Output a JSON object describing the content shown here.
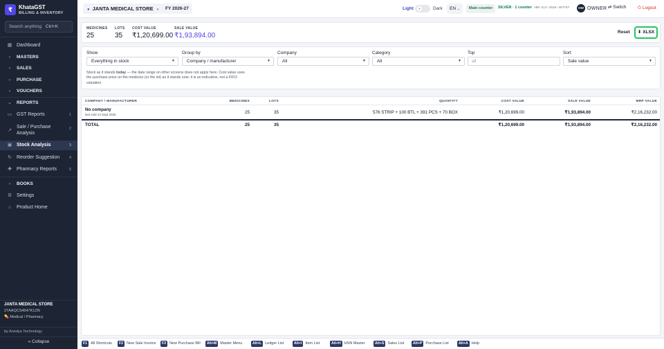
{
  "app": {
    "name": "KhataGST",
    "subtitle": "BILLING & INVENTORY",
    "logo_glyph": "₹"
  },
  "search": {
    "placeholder": "Search anything",
    "shortcut": "Ctrl+K"
  },
  "sidebar": {
    "items": [
      {
        "label": "Dashboard",
        "icon": "grid-icon"
      },
      {
        "label": "MASTERS",
        "icon": "chevron-right-icon"
      },
      {
        "label": "SALES",
        "icon": "chevron-right-icon"
      },
      {
        "label": "PURCHASE",
        "icon": "chevron-right-icon"
      },
      {
        "label": "VOUCHERS",
        "icon": "chevron-right-icon"
      },
      {
        "label": "REPORTS",
        "icon": "chevron-down-icon"
      },
      {
        "label": "GST Reports",
        "num": "1"
      },
      {
        "label": "Sale / Purchase Analysis",
        "num": "2"
      },
      {
        "label": "Stock Analysis",
        "num": "3"
      },
      {
        "label": "Reorder Suggestion",
        "num": "4"
      },
      {
        "label": "Pharmacy Reports",
        "num": "5"
      },
      {
        "label": "BOOKS",
        "icon": "chevron-right-icon"
      },
      {
        "label": "Settings",
        "icon": "gear-icon"
      },
      {
        "label": "Product Home",
        "icon": "home-icon"
      }
    ],
    "store": {
      "name": "JANTA MEDICAL STORE",
      "gstin": "27AAQCS4547K1ZN",
      "type": "Medical / Pharmacy"
    },
    "by": "by Anedya Technology",
    "collapse": "« Collapse"
  },
  "topbar": {
    "store": "JANTA MEDICAL STORE",
    "fy": "FY 2026-27",
    "theme_light": "Light",
    "theme_dark": "Dark",
    "lang": "EN",
    "main_counter": "Main counter",
    "plan": "SILVER · 1 counter",
    "plan_code": "ANO-SLV-2026-467F97",
    "owner_avatar": "OW",
    "owner": "OWNER",
    "switch": "Switch",
    "logout": "Logout"
  },
  "summary": {
    "medicines_label": "MEDICINES",
    "medicines": "25",
    "lots_label": "LOTS",
    "lots": "35",
    "cost_label": "COST VALUE",
    "cost": "₹1,20,699.00",
    "sale_label": "SALE VALUE",
    "sale": "₹1,93,894.00",
    "reset": "Reset",
    "export": "XLSX"
  },
  "filters": {
    "show_label": "Show",
    "show": "Everything in stock",
    "group_label": "Group by",
    "group": "Company / manufacturer",
    "company_label": "Company",
    "company": "All",
    "category_label": "Category",
    "category": "All",
    "top_label": "Top",
    "top_placeholder": "all",
    "sort_label": "Sort",
    "sort": "Sale value",
    "note_a": "Stock as it stands ",
    "note_b": "today",
    "note_c": " — the date range on other screens does not apply here. Cost value uses the purchase price on the medicine (or the lot) as it stands now; it is an indication, not a FIFO valuation."
  },
  "table": {
    "headers": {
      "company": "COMPANY / MANUFACTURER",
      "medicines": "MEDICINES",
      "lots": "LOTS",
      "quantity": "QUANTITY",
      "cost": "COST VALUE",
      "sale": "SALE VALUE",
      "mrp": "MRP VALUE"
    },
    "rows": [
      {
        "company": "No company",
        "sub": "last sold 13 Sept 2026",
        "medicines": "25",
        "lots": "35",
        "quantity": "576 STRIP + 100 BTL + 391 PCS + 70 BOX",
        "cost": "₹1,20,699.00",
        "sale": "₹1,93,894.00",
        "mrp": "₹2,16,232.00"
      }
    ],
    "total": {
      "label": "TOTAL",
      "medicines": "25",
      "lots": "35",
      "cost": "₹1,20,699.00",
      "sale": "₹1,93,894.00",
      "mrp": "₹2,16,232.00"
    }
  },
  "shortcuts": [
    {
      "key": "F1",
      "label": "All Shortcuts"
    },
    {
      "key": "F2",
      "label": "New Sale Invoice"
    },
    {
      "key": "F3",
      "label": "New Purchase Bill"
    },
    {
      "key": "Alt+M",
      "label": "Master Menu"
    },
    {
      "key": "Alt+L",
      "label": "Ledger List"
    },
    {
      "key": "Alt+I",
      "label": "Item List"
    },
    {
      "key": "Alt+H",
      "label": "HSN Master"
    },
    {
      "key": "Alt+S",
      "label": "Sales List"
    },
    {
      "key": "Alt+P",
      "label": "Purchase List"
    },
    {
      "key": "Alt+A",
      "label": "Help"
    }
  ],
  "colors": {
    "sidebar": "#1d2433",
    "accent": "#4f46e5",
    "export_border": "#22c55e",
    "logout": "#dc2626"
  }
}
